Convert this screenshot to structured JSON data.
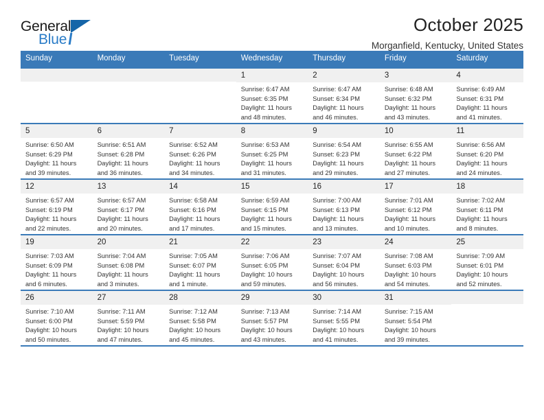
{
  "brand": {
    "name_top": "General",
    "name_bottom": "Blue",
    "accent_color": "#2a7cc7",
    "triangle_color": "#1565a8"
  },
  "header": {
    "title": "October 2025",
    "subtitle": "Morganfield, Kentucky, United States"
  },
  "theme": {
    "header_row_bg": "#3a7ab8",
    "daynum_bg": "#f0f0f0",
    "border_color": "#3a7ab8",
    "text_color": "#333333"
  },
  "weekday_headers": [
    "Sunday",
    "Monday",
    "Tuesday",
    "Wednesday",
    "Thursday",
    "Friday",
    "Saturday"
  ],
  "weeks": [
    [
      {
        "day": "",
        "sunrise": "",
        "sunset": "",
        "daylight_line1": "",
        "daylight_line2": "",
        "empty": true
      },
      {
        "day": "",
        "sunrise": "",
        "sunset": "",
        "daylight_line1": "",
        "daylight_line2": "",
        "empty": true
      },
      {
        "day": "",
        "sunrise": "",
        "sunset": "",
        "daylight_line1": "",
        "daylight_line2": "",
        "empty": true
      },
      {
        "day": "1",
        "sunrise": "Sunrise: 6:47 AM",
        "sunset": "Sunset: 6:35 PM",
        "daylight_line1": "Daylight: 11 hours",
        "daylight_line2": "and 48 minutes."
      },
      {
        "day": "2",
        "sunrise": "Sunrise: 6:47 AM",
        "sunset": "Sunset: 6:34 PM",
        "daylight_line1": "Daylight: 11 hours",
        "daylight_line2": "and 46 minutes."
      },
      {
        "day": "3",
        "sunrise": "Sunrise: 6:48 AM",
        "sunset": "Sunset: 6:32 PM",
        "daylight_line1": "Daylight: 11 hours",
        "daylight_line2": "and 43 minutes."
      },
      {
        "day": "4",
        "sunrise": "Sunrise: 6:49 AM",
        "sunset": "Sunset: 6:31 PM",
        "daylight_line1": "Daylight: 11 hours",
        "daylight_line2": "and 41 minutes."
      }
    ],
    [
      {
        "day": "5",
        "sunrise": "Sunrise: 6:50 AM",
        "sunset": "Sunset: 6:29 PM",
        "daylight_line1": "Daylight: 11 hours",
        "daylight_line2": "and 39 minutes."
      },
      {
        "day": "6",
        "sunrise": "Sunrise: 6:51 AM",
        "sunset": "Sunset: 6:28 PM",
        "daylight_line1": "Daylight: 11 hours",
        "daylight_line2": "and 36 minutes."
      },
      {
        "day": "7",
        "sunrise": "Sunrise: 6:52 AM",
        "sunset": "Sunset: 6:26 PM",
        "daylight_line1": "Daylight: 11 hours",
        "daylight_line2": "and 34 minutes."
      },
      {
        "day": "8",
        "sunrise": "Sunrise: 6:53 AM",
        "sunset": "Sunset: 6:25 PM",
        "daylight_line1": "Daylight: 11 hours",
        "daylight_line2": "and 31 minutes."
      },
      {
        "day": "9",
        "sunrise": "Sunrise: 6:54 AM",
        "sunset": "Sunset: 6:23 PM",
        "daylight_line1": "Daylight: 11 hours",
        "daylight_line2": "and 29 minutes."
      },
      {
        "day": "10",
        "sunrise": "Sunrise: 6:55 AM",
        "sunset": "Sunset: 6:22 PM",
        "daylight_line1": "Daylight: 11 hours",
        "daylight_line2": "and 27 minutes."
      },
      {
        "day": "11",
        "sunrise": "Sunrise: 6:56 AM",
        "sunset": "Sunset: 6:20 PM",
        "daylight_line1": "Daylight: 11 hours",
        "daylight_line2": "and 24 minutes."
      }
    ],
    [
      {
        "day": "12",
        "sunrise": "Sunrise: 6:57 AM",
        "sunset": "Sunset: 6:19 PM",
        "daylight_line1": "Daylight: 11 hours",
        "daylight_line2": "and 22 minutes."
      },
      {
        "day": "13",
        "sunrise": "Sunrise: 6:57 AM",
        "sunset": "Sunset: 6:17 PM",
        "daylight_line1": "Daylight: 11 hours",
        "daylight_line2": "and 20 minutes."
      },
      {
        "day": "14",
        "sunrise": "Sunrise: 6:58 AM",
        "sunset": "Sunset: 6:16 PM",
        "daylight_line1": "Daylight: 11 hours",
        "daylight_line2": "and 17 minutes."
      },
      {
        "day": "15",
        "sunrise": "Sunrise: 6:59 AM",
        "sunset": "Sunset: 6:15 PM",
        "daylight_line1": "Daylight: 11 hours",
        "daylight_line2": "and 15 minutes."
      },
      {
        "day": "16",
        "sunrise": "Sunrise: 7:00 AM",
        "sunset": "Sunset: 6:13 PM",
        "daylight_line1": "Daylight: 11 hours",
        "daylight_line2": "and 13 minutes."
      },
      {
        "day": "17",
        "sunrise": "Sunrise: 7:01 AM",
        "sunset": "Sunset: 6:12 PM",
        "daylight_line1": "Daylight: 11 hours",
        "daylight_line2": "and 10 minutes."
      },
      {
        "day": "18",
        "sunrise": "Sunrise: 7:02 AM",
        "sunset": "Sunset: 6:11 PM",
        "daylight_line1": "Daylight: 11 hours",
        "daylight_line2": "and 8 minutes."
      }
    ],
    [
      {
        "day": "19",
        "sunrise": "Sunrise: 7:03 AM",
        "sunset": "Sunset: 6:09 PM",
        "daylight_line1": "Daylight: 11 hours",
        "daylight_line2": "and 6 minutes."
      },
      {
        "day": "20",
        "sunrise": "Sunrise: 7:04 AM",
        "sunset": "Sunset: 6:08 PM",
        "daylight_line1": "Daylight: 11 hours",
        "daylight_line2": "and 3 minutes."
      },
      {
        "day": "21",
        "sunrise": "Sunrise: 7:05 AM",
        "sunset": "Sunset: 6:07 PM",
        "daylight_line1": "Daylight: 11 hours",
        "daylight_line2": "and 1 minute."
      },
      {
        "day": "22",
        "sunrise": "Sunrise: 7:06 AM",
        "sunset": "Sunset: 6:05 PM",
        "daylight_line1": "Daylight: 10 hours",
        "daylight_line2": "and 59 minutes."
      },
      {
        "day": "23",
        "sunrise": "Sunrise: 7:07 AM",
        "sunset": "Sunset: 6:04 PM",
        "daylight_line1": "Daylight: 10 hours",
        "daylight_line2": "and 56 minutes."
      },
      {
        "day": "24",
        "sunrise": "Sunrise: 7:08 AM",
        "sunset": "Sunset: 6:03 PM",
        "daylight_line1": "Daylight: 10 hours",
        "daylight_line2": "and 54 minutes."
      },
      {
        "day": "25",
        "sunrise": "Sunrise: 7:09 AM",
        "sunset": "Sunset: 6:01 PM",
        "daylight_line1": "Daylight: 10 hours",
        "daylight_line2": "and 52 minutes."
      }
    ],
    [
      {
        "day": "26",
        "sunrise": "Sunrise: 7:10 AM",
        "sunset": "Sunset: 6:00 PM",
        "daylight_line1": "Daylight: 10 hours",
        "daylight_line2": "and 50 minutes."
      },
      {
        "day": "27",
        "sunrise": "Sunrise: 7:11 AM",
        "sunset": "Sunset: 5:59 PM",
        "daylight_line1": "Daylight: 10 hours",
        "daylight_line2": "and 47 minutes."
      },
      {
        "day": "28",
        "sunrise": "Sunrise: 7:12 AM",
        "sunset": "Sunset: 5:58 PM",
        "daylight_line1": "Daylight: 10 hours",
        "daylight_line2": "and 45 minutes."
      },
      {
        "day": "29",
        "sunrise": "Sunrise: 7:13 AM",
        "sunset": "Sunset: 5:57 PM",
        "daylight_line1": "Daylight: 10 hours",
        "daylight_line2": "and 43 minutes."
      },
      {
        "day": "30",
        "sunrise": "Sunrise: 7:14 AM",
        "sunset": "Sunset: 5:55 PM",
        "daylight_line1": "Daylight: 10 hours",
        "daylight_line2": "and 41 minutes."
      },
      {
        "day": "31",
        "sunrise": "Sunrise: 7:15 AM",
        "sunset": "Sunset: 5:54 PM",
        "daylight_line1": "Daylight: 10 hours",
        "daylight_line2": "and 39 minutes."
      },
      {
        "day": "",
        "sunrise": "",
        "sunset": "",
        "daylight_line1": "",
        "daylight_line2": "",
        "empty": true
      }
    ]
  ]
}
